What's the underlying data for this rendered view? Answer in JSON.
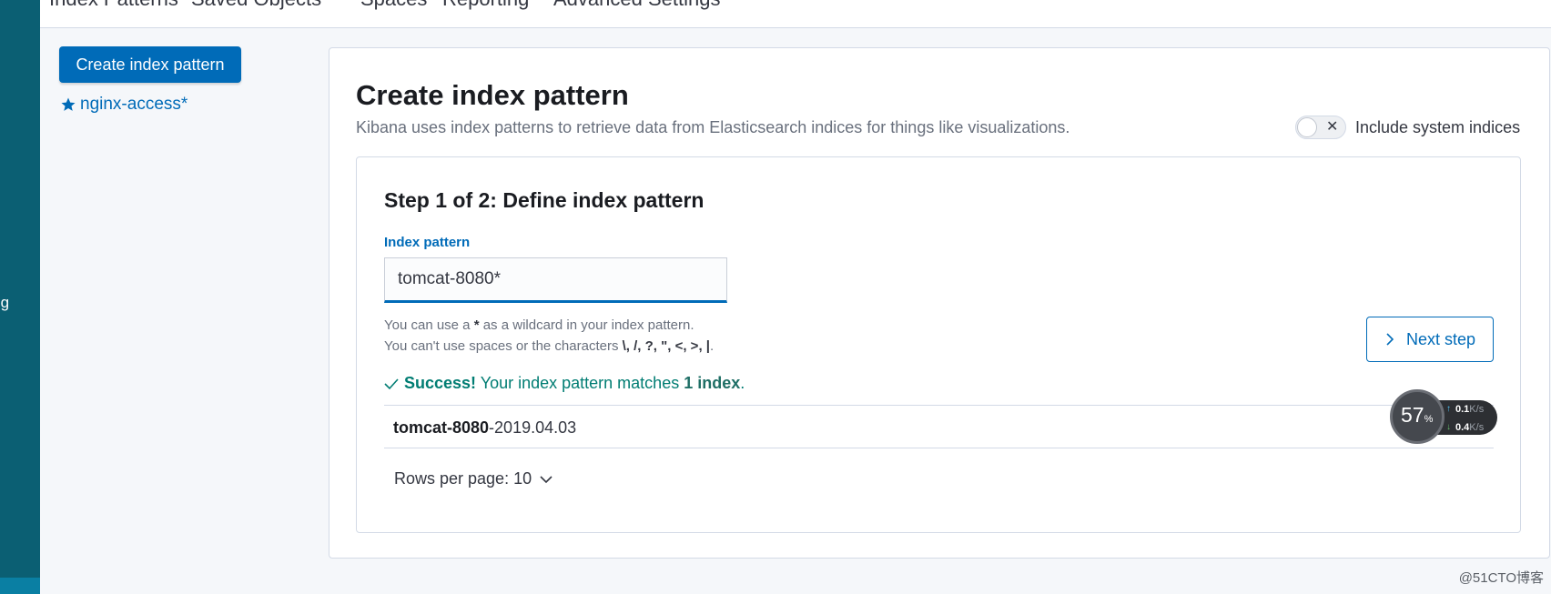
{
  "side_nav": {
    "partial_text": "ning"
  },
  "top_tabs": [
    {
      "label": "Index Patterns"
    },
    {
      "label": "Saved Objects"
    },
    {
      "label": "Spaces"
    },
    {
      "label": "Reporting"
    },
    {
      "label": "Advanced Settings"
    }
  ],
  "sidebar": {
    "create_button_label": "Create index pattern",
    "saved_patterns": [
      {
        "label": "nginx-access*",
        "icon": "star-icon"
      }
    ]
  },
  "main": {
    "title": "Create index pattern",
    "description": "Kibana uses index patterns to retrieve data from Elasticsearch indices for things like visualizations.",
    "system_indices_toggle": {
      "label": "Include system indices",
      "checked": false
    }
  },
  "step": {
    "title": "Step 1 of 2: Define index pattern",
    "field_label": "Index pattern",
    "field_value": "tomcat-8080*",
    "help_line1_prefix": "You can use a ",
    "help_line1_star": "*",
    "help_line1_suffix": " as a wildcard in your index pattern.",
    "help_line2_prefix": "You can't use spaces or the characters ",
    "help_line2_chars": "\\, /, ?, \", <, >, |",
    "help_line2_suffix": ".",
    "next_button_label": "Next step",
    "success_label": "Success!",
    "success_text": " Your index pattern matches ",
    "success_count": "1 index",
    "success_end": ".",
    "match": {
      "bold": "tomcat-8080",
      "rest": "-2019.04.03"
    },
    "rows_per_page": "Rows per page: 10"
  },
  "net_widget": {
    "percent": "57",
    "percent_sign": "%",
    "up_speed": "0.1",
    "up_unit": "K/s",
    "down_speed": "0.4",
    "down_unit": "K/s"
  },
  "watermark": "@51CTO博客",
  "colors": {
    "accent": "#006bb8",
    "success": "#017d73",
    "nav": "#0b5f73"
  }
}
